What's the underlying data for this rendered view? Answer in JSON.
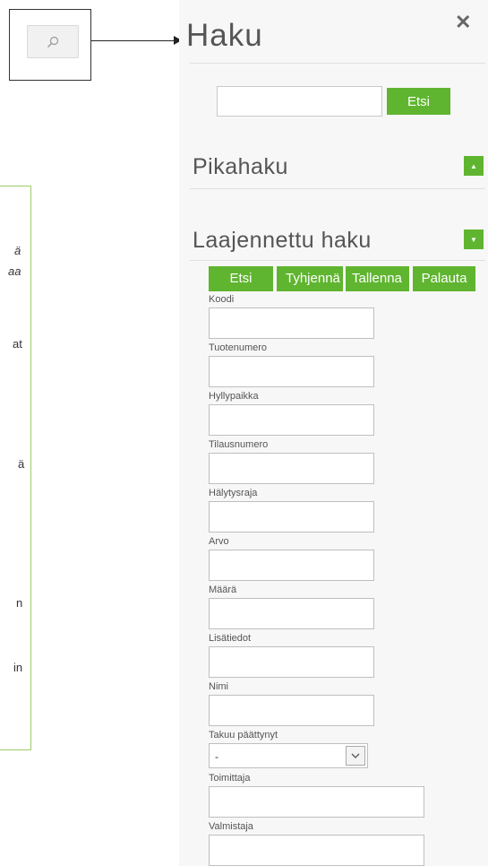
{
  "panel": {
    "title": "Haku",
    "close_icon": "close-icon",
    "search_placeholder": "",
    "search_button": "Etsi",
    "quick_search_title": "Pikahaku",
    "quick_search_toggle": "▲",
    "advanced_search_title": "Laajennettu haku",
    "advanced_search_toggle": "▼"
  },
  "actions": [
    "Etsi",
    "Tyhjennä",
    "Tallenna",
    "Palauta"
  ],
  "fields": [
    {
      "label": "Koodi",
      "value": ""
    },
    {
      "label": "Tuotenumero",
      "value": ""
    },
    {
      "label": "Hyllypaikka",
      "value": ""
    },
    {
      "label": "Tilausnumero",
      "value": ""
    },
    {
      "label": "Hälytysraja",
      "value": ""
    },
    {
      "label": "Arvo",
      "value": ""
    },
    {
      "label": "Määrä",
      "value": ""
    },
    {
      "label": "Lisätiedot",
      "value": ""
    },
    {
      "label": "Nimi",
      "value": ""
    }
  ],
  "warranty": {
    "label": "Takuu päättynyt",
    "selected": "-"
  },
  "supplier": {
    "label": "Toimittaja",
    "value": ""
  },
  "manufacturer": {
    "label": "Valmistaja",
    "value": ""
  },
  "note_fragments": [
    "ä",
    "aa",
    "at",
    "ä",
    "n",
    "in"
  ],
  "accent_color": "#5fb52f"
}
